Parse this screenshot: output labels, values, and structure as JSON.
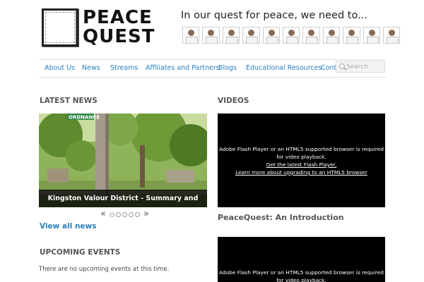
{
  "header": {
    "logo_line1": "PEACE",
    "logo_line2": "QUEST",
    "tagline": "In our quest for peace, we need to..."
  },
  "nav": {
    "items": [
      {
        "label": "About Us"
      },
      {
        "label": "News"
      },
      {
        "label": "Streams"
      },
      {
        "label": "Affiliates and Partners"
      },
      {
        "label": "Blogs"
      },
      {
        "label": "Educational Resources"
      },
      {
        "label": "Contact"
      }
    ],
    "search_placeholder": "Search"
  },
  "news": {
    "heading": "LATEST NEWS",
    "sign_text": "ORDNANCE",
    "slide_caption": "Kingston Valour District - Summary and Timeline",
    "pager_prev": "«",
    "pager_next": "»",
    "view_all": "View all news"
  },
  "events": {
    "heading": "UPCOMING EVENTS",
    "empty_text": "There are no upcoming events at this time."
  },
  "videos": {
    "heading": "VIDEOS",
    "player1": {
      "message": "Adobe Flash Player or an HTML5 supported browser is required for video playback.",
      "link1": "Get the latest Flash Player.",
      "link2": "Learn more about upgrading to an HTML5 browser"
    },
    "intro_title": "PeaceQuest: An Introduction",
    "player2": {
      "message": "Adobe Flash Player or an HTML5 supported browser is required for video playback."
    }
  }
}
